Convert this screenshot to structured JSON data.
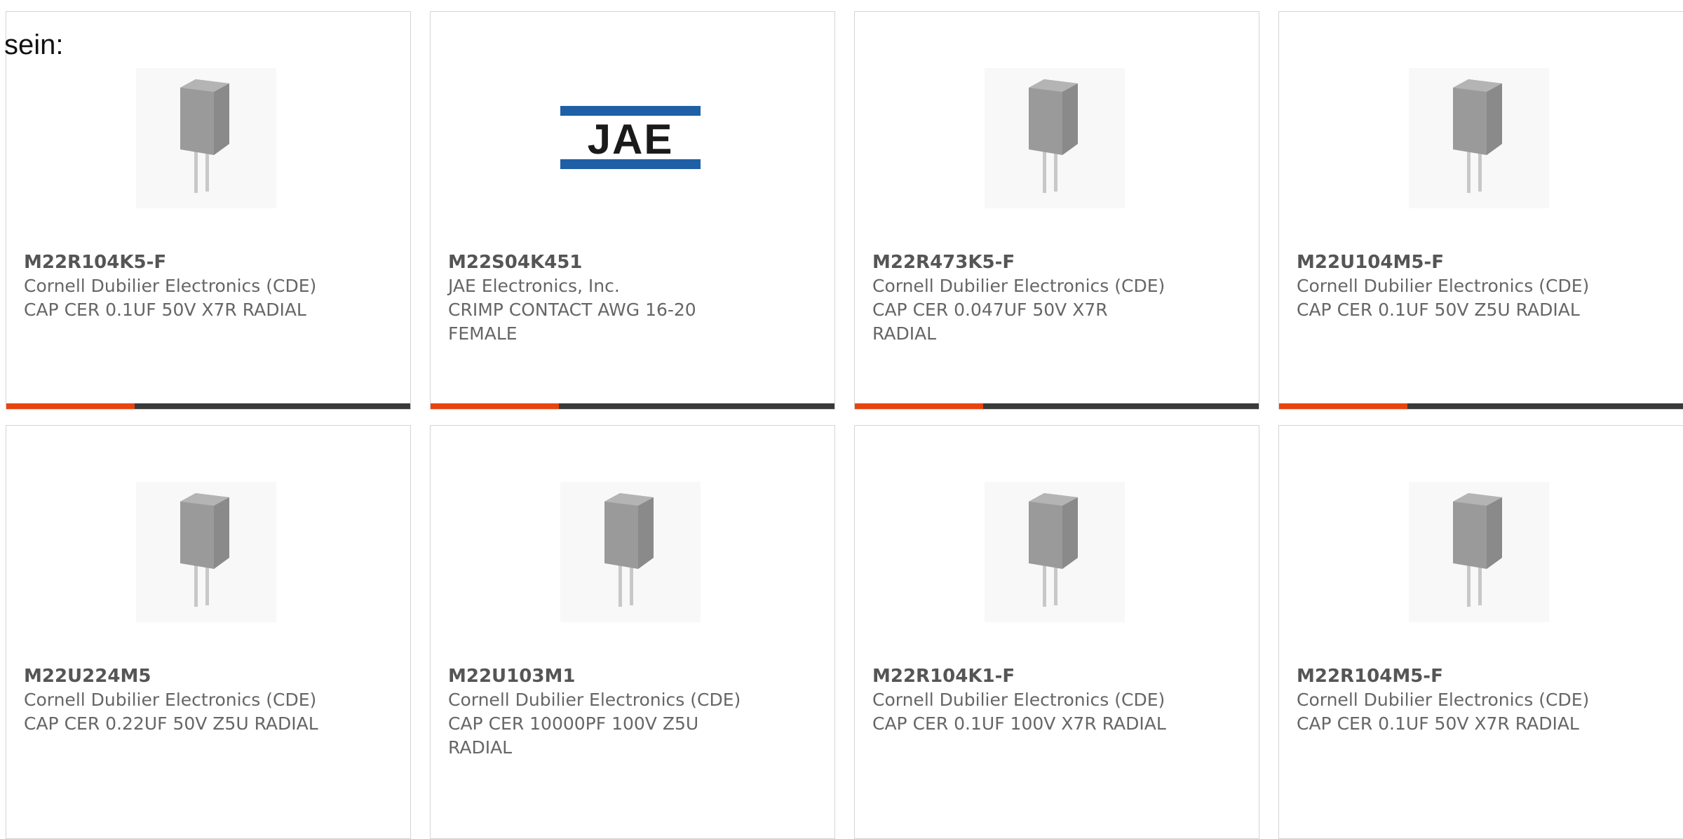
{
  "intro_text": "sein:",
  "products": [
    {
      "part_number": "M22R104K5-F",
      "manufacturer": "Cornell Dubilier Electronics (CDE)",
      "description": "CAP CER 0.1UF 50V X7R RADIAL",
      "image": "capacitor-image",
      "accent_color": "#e8440f"
    },
    {
      "part_number": "M22S04K451",
      "manufacturer": "JAE Electronics, Inc.",
      "description": "CRIMP CONTACT AWG 16-20 FEMALE",
      "image": "jae-logo",
      "logo_text": "JAE",
      "logo_color": "#1e5fa6",
      "accent_color": "#e8440f"
    },
    {
      "part_number": "M22R473K5-F",
      "manufacturer": "Cornell Dubilier Electronics (CDE)",
      "description": "CAP CER 0.047UF 50V X7R RADIAL",
      "image": "capacitor-image",
      "accent_color": "#e8440f"
    },
    {
      "part_number": "M22U104M5-F",
      "manufacturer": "Cornell Dubilier Electronics (CDE)",
      "description": "CAP CER 0.1UF 50V Z5U RADIAL",
      "image": "capacitor-image",
      "accent_color": "#e8440f"
    },
    {
      "part_number": "M22U224M5",
      "manufacturer": "Cornell Dubilier Electronics (CDE)",
      "description": "CAP CER 0.22UF 50V Z5U RADIAL",
      "image": "capacitor-image"
    },
    {
      "part_number": "M22U103M1",
      "manufacturer": "Cornell Dubilier Electronics (CDE)",
      "description": "CAP CER 10000PF 100V Z5U RADIAL",
      "image": "capacitor-image"
    },
    {
      "part_number": "M22R104K1-F",
      "manufacturer": "Cornell Dubilier Electronics (CDE)",
      "description": "CAP CER 0.1UF 100V X7R RADIAL",
      "image": "capacitor-image"
    },
    {
      "part_number": "M22R104M5-F",
      "manufacturer": "Cornell Dubilier Electronics (CDE)",
      "description": "CAP CER 0.1UF 50V X7R RADIAL",
      "image": "capacitor-image"
    }
  ]
}
